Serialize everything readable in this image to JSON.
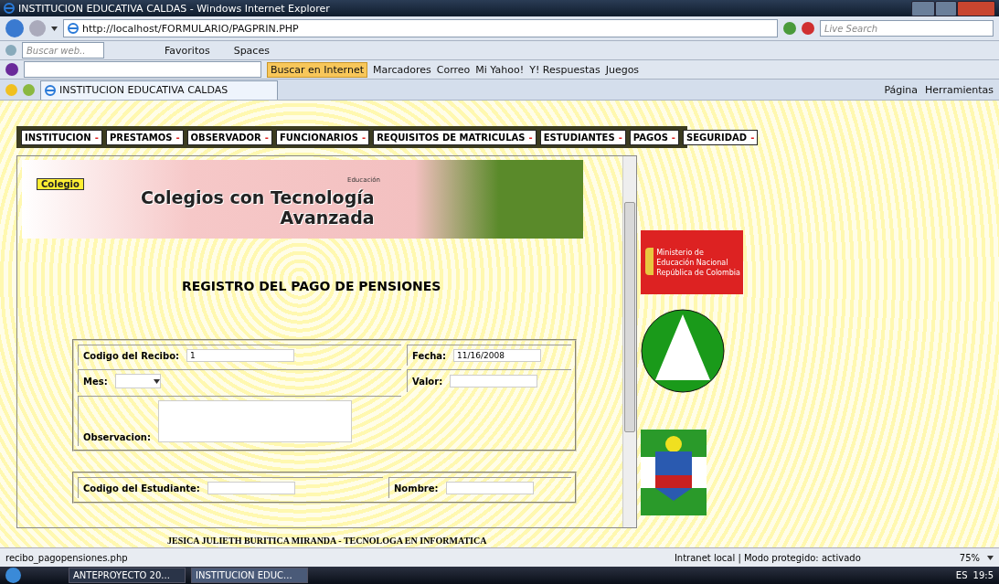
{
  "window": {
    "title": "INSTITUCION EDUCATIVA CALDAS - Windows Internet Explorer"
  },
  "address_bar": {
    "url": "http://localhost/FORMULARIO/PAGPRIN.PHP",
    "search_placeholder": "Live Search"
  },
  "toolbar": {
    "search_placeholder": "Buscar web..",
    "items": [
      "Favoritos",
      "Spaces"
    ]
  },
  "yahoo_bar": {
    "search_button": "Buscar en Internet",
    "items": [
      "Marcadores",
      "Correo",
      "Mi Yahoo!",
      "Y! Respuestas",
      "Juegos"
    ]
  },
  "tab": {
    "title": "INSTITUCION EDUCATIVA CALDAS"
  },
  "command_bar": {
    "items": [
      "Página",
      "Herramientas"
    ]
  },
  "menu": [
    {
      "label": "INSTITUCION",
      "marker": "-"
    },
    {
      "label": "PRESTAMOS",
      "marker": "-"
    },
    {
      "label": "OBSERVADOR",
      "marker": "-"
    },
    {
      "label": "FUNCIONARIOS",
      "marker": "-"
    },
    {
      "label": "REQUISITOS DE MATRICULAS",
      "marker": "-"
    },
    {
      "label": "ESTUDIANTES",
      "marker": "-"
    },
    {
      "label": "PAGOS",
      "marker": "-"
    },
    {
      "label": "SEGURIDAD",
      "marker": "-"
    }
  ],
  "banner": {
    "badge": "Colegio",
    "title_line_1": "Colegios con Tecnología",
    "title_line_2": "Avanzada",
    "agency": "Educación"
  },
  "form": {
    "heading": "REGISTRO DEL PAGO DE PENSIONES",
    "fields": [
      {
        "label": "Codigo del Recibo:",
        "value": "1"
      },
      {
        "label": "Fecha:",
        "value": "11/16/2008"
      },
      {
        "label": "Mes:",
        "kind": "select"
      },
      {
        "label": "Valor:"
      }
    ],
    "observation": {
      "label": "Observacion:"
    },
    "student_fields": [
      {
        "label": "Codigo del Estudiante:"
      },
      {
        "label": "Nombre:"
      }
    ]
  },
  "footer": "JESICA JULIETH BURITICA MIRANDA - TECNOLOGA EN INFORMATICA",
  "ministry_logo": {
    "lines": [
      "Ministerio de",
      "Educación Nacional",
      "República de Colombia"
    ]
  },
  "status_bar": {
    "text": "recibo_pagopensiones.php",
    "zone": "Intranet local | Modo protegido: activado",
    "zoom": "75%"
  },
  "taskbar": {
    "buttons": [
      {
        "label": "ANTEPROYECTO 20...",
        "selected": false
      },
      {
        "label": "INSTITUCION EDUC...",
        "selected": true
      }
    ],
    "language": "ES",
    "clock": "19:5"
  }
}
